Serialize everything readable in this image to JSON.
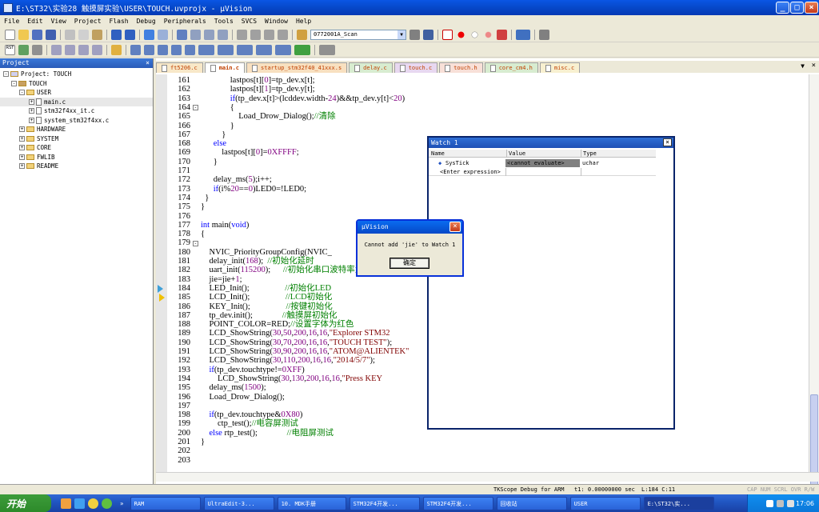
{
  "window": {
    "title": "E:\\ST32\\实验28 触摸屏实验\\USER\\TOUCH.uvprojx - µVision"
  },
  "menu": [
    "File",
    "Edit",
    "View",
    "Project",
    "Flash",
    "Debug",
    "Peripherals",
    "Tools",
    "SVCS",
    "Window",
    "Help"
  ],
  "toolbar": {
    "target": "0772001A_Scan"
  },
  "project": {
    "title": "Project",
    "tree": [
      {
        "label": "Project: TOUCH",
        "depth": 0,
        "type": "root",
        "pm": "-"
      },
      {
        "label": "TOUCH",
        "depth": 1,
        "type": "target",
        "pm": "-"
      },
      {
        "label": "USER",
        "depth": 2,
        "type": "folder",
        "pm": "-"
      },
      {
        "label": "main.c",
        "depth": 3,
        "type": "file",
        "pm": "+",
        "selected": true
      },
      {
        "label": "stm32f4xx_it.c",
        "depth": 3,
        "type": "file",
        "pm": "+"
      },
      {
        "label": "system_stm32f4xx.c",
        "depth": 3,
        "type": "file",
        "pm": "+"
      },
      {
        "label": "HARDWARE",
        "depth": 2,
        "type": "folder",
        "pm": "+"
      },
      {
        "label": "SYSTEM",
        "depth": 2,
        "type": "folder",
        "pm": "+"
      },
      {
        "label": "CORE",
        "depth": 2,
        "type": "folder",
        "pm": "+"
      },
      {
        "label": "FWLIB",
        "depth": 2,
        "type": "folder",
        "pm": "+"
      },
      {
        "label": "README",
        "depth": 2,
        "type": "folder",
        "pm": "+"
      }
    ]
  },
  "tabs": [
    "ft5206.c",
    "main.c",
    "startup_stm32f40_41xxx.s",
    "delay.c",
    "touch.c",
    "touch.h",
    "core_cm4.h",
    "misc.c"
  ],
  "active_tab": "main.c",
  "code": {
    "line_numbers": [
      "161",
      "162",
      "163",
      "164",
      "165",
      "166",
      "167",
      "168",
      "169",
      "170",
      "171",
      "172",
      "173",
      "174",
      "175",
      "176",
      "177",
      "178",
      "179",
      "180",
      "181",
      "182",
      "183",
      "184",
      "185",
      "186",
      "187",
      "188",
      "189",
      "190",
      "191",
      "192",
      "193",
      "194",
      "195",
      "196",
      "197",
      "198",
      "199",
      "200",
      "201",
      "202",
      "203"
    ],
    "lines": [
      "              lastpos[t][0]=tp_dev.x[t];",
      "              lastpos[t][1]=tp_dev.y[t];",
      "              if(tp_dev.x[t]>(lcddev.width-24)&&tp_dev.y[t]<20)",
      "              {",
      "                  Load_Drow_Dialog();//清除",
      "              }",
      "          }",
      "      else",
      "          lastpos[t][0]=0XFFFF;",
      "      }",
      "",
      "      delay_ms(5);i++;",
      "      if(i%20==0)LED0=!LED0;",
      "  }",
      "}",
      "",
      "int main(void)",
      "{",
      "",
      "    NVIC_PriorityGroupConfig(NVIC_",
      "    delay_init(168);  //初始化延时",
      "    uart_init(115200);      //初始化串口波特率为11",
      "    jie=jie+1;",
      "    LED_Init();                 //初始化LED",
      "    LCD_Init();                 //LCD初始化",
      "    KEY_Init();                 //按键初始化",
      "    tp_dev.init();              //触摸屏初始化",
      "    POINT_COLOR=RED;//设置字体为红色",
      "    LCD_ShowString(30,50,200,16,16,\"Explorer STM32",
      "    LCD_ShowString(30,70,200,16,16,\"TOUCH TEST\");",
      "    LCD_ShowString(30,90,200,16,16,\"ATOM@ALIENTEK\"",
      "    LCD_ShowString(30,110,200,16,16,\"2014/5/7\");",
      "    if(tp_dev.touchtype!=0XFF)",
      "        LCD_ShowString(30,130,200,16,16,\"Press KEY",
      "    delay_ms(1500);",
      "    Load_Drow_Dialog();",
      "",
      "    if(tp_dev.touchtype&0X80)",
      "        ctp_test();//电容屏测试",
      "    else rtp_test();              //电阻屏测试",
      "}",
      ""
    ]
  },
  "watch": {
    "title": "Watch 1",
    "headers": [
      "Name",
      "Value",
      "Type"
    ],
    "rows": [
      {
        "name": "SysTick",
        "value": "<cannot evaluate>",
        "type": "uchar"
      },
      {
        "name": "<Enter expression>",
        "value": "",
        "type": ""
      }
    ]
  },
  "dialog": {
    "title": "µVision",
    "message": "Cannot add 'jie' to Watch 1",
    "ok": "确定"
  },
  "status": {
    "debugger": "TKScope Debug for ARM",
    "time": "t1: 0.00000000 sec",
    "pos": "L:184 C:11",
    "flags": "CAP NUM SCRL OVR R/W"
  },
  "taskbar": {
    "start": "开始",
    "tasks": [
      "RAM",
      "UltraEdit-3...",
      "10. MDK手册",
      "STM32F4开发...",
      "STM32F4开发...",
      "回收站",
      "USER",
      "E:\\ST32\\实..."
    ],
    "clock": "17:06"
  }
}
